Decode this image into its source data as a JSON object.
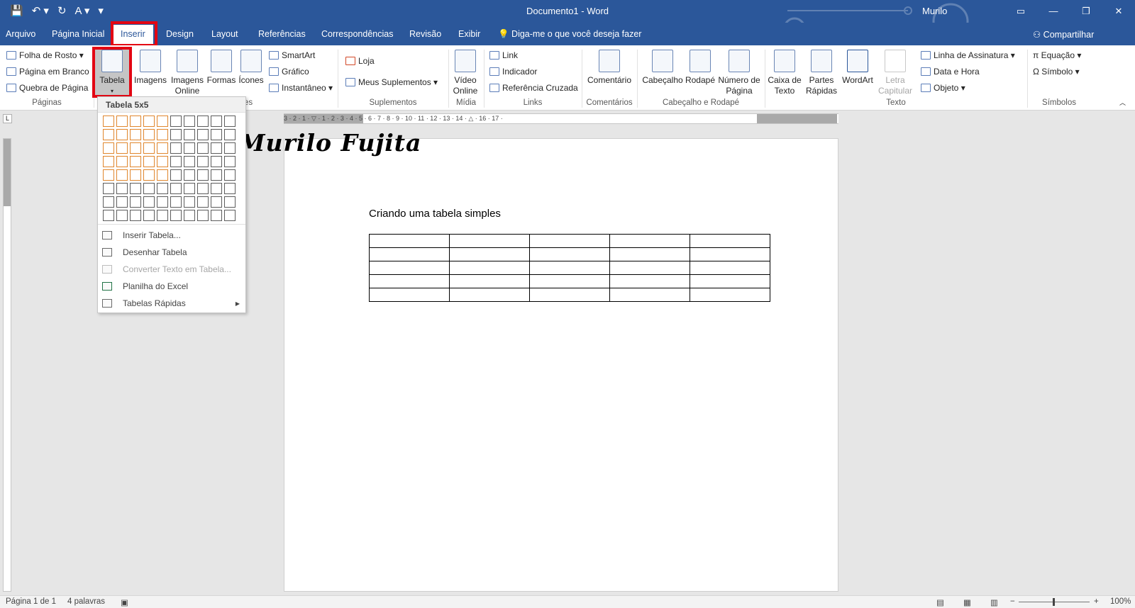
{
  "titlebar": {
    "qat": [
      "💾",
      "↶ ▾",
      "↻",
      "A ▾",
      "▾"
    ],
    "title": "Documento1 - Word",
    "user": "Murilo",
    "win_controls": [
      "▭",
      "—",
      "❐",
      "✕"
    ]
  },
  "tabs": [
    "Arquivo",
    "Página Inicial",
    "Inserir",
    "Design",
    "Layout",
    "Referências",
    "Correspondências",
    "Revisão",
    "Exibir"
  ],
  "active_tab": "Inserir",
  "tellme": "💡 Diga-me o que você deseja fazer",
  "share": "⚇ Compartilhar",
  "ribbon": {
    "paginas": [
      "Folha de Rosto ▾",
      "Página em Branco",
      "Quebra de Página"
    ],
    "tabela": "Tabela",
    "tabela_arrow": "▾",
    "imagens": "Imagens",
    "imagens_online": "Imagens Online",
    "formas": "Formas",
    "icones": "Ícones",
    "smartart": "SmartArt",
    "grafico": "Gráfico",
    "instantaneo": "Instantâneo ▾",
    "loja": "Loja",
    "meus_suplementos": "Meus Suplementos ▾",
    "video_online": "Vídeo Online",
    "link": "Link",
    "indicador": "Indicador",
    "referencia_cruzada": "Referência Cruzada",
    "comentario": "Comentário",
    "cabecalho": "Cabeçalho",
    "rodape": "Rodapé",
    "numero_pagina": "Número de Página",
    "caixa_texto": "Caixa de Texto",
    "partes_rapidas": "Partes Rápidas",
    "wordart": "WordArt",
    "letra_capitular": "Letra Capitular",
    "linha_assinatura": "Linha de Assinatura ▾",
    "data_hora": "Data e Hora",
    "objeto": "Objeto ▾",
    "equacao": "π Equação ▾",
    "simbolo": "Ω Símbolo ▾",
    "groups": [
      "Páginas",
      "es",
      "Suplementos",
      "Mídia",
      "Links",
      "Comentários",
      "Cabeçalho e Rodapé",
      "Texto",
      "Símbolos"
    ]
  },
  "dropdown": {
    "header": "Tabela 5x5",
    "grid_cols": 10,
    "grid_rows": 8,
    "selected_cols": 5,
    "selected_rows": 5,
    "items": [
      "Inserir Tabela...",
      "Desenhar Tabela",
      "Converter Texto em Tabela...",
      "Planilha do Excel",
      "Tabelas Rápidas"
    ]
  },
  "ruler": {
    "corner": "L",
    "numbers": "3 · 2 · 1 · ▽ · 1 · 2 · 3 · 4 · 5 · 6 · 7 · 8 · 9 · 10 · 11 · 12 · 13 · 14 · △ · 16 · 17 ·"
  },
  "document": {
    "watermark": "Murilo Fujita",
    "heading": "Criando uma tabela simples",
    "table_rows": 5,
    "table_cols": 5
  },
  "status": {
    "page": "Página 1 de 1",
    "words": "4 palavras",
    "zoom": "100%"
  }
}
